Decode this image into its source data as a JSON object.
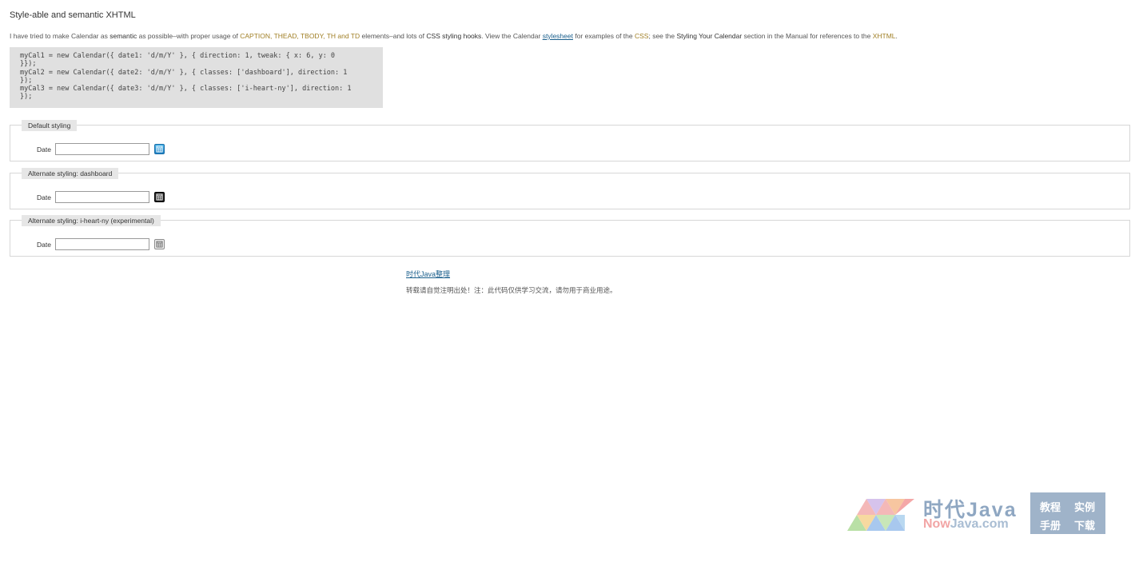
{
  "heading": "Style-able and semantic XHTML",
  "intro": {
    "t1": "I have tried to make Calendar as ",
    "semantic": "semantic",
    "t2": " as possible–with proper usage of ",
    "tags": "CAPTION, THEAD, TBODY, TH and TD",
    "t3": " elements–and lots of ",
    "css_hooks": "CSS styling hooks",
    "t4": ". View the Calendar ",
    "stylesheet_link": "stylesheet",
    "t5": " for examples of the ",
    "css": "CSS",
    "t6": "; see the ",
    "styling_section": "Styling Your Calendar",
    "t7": " section in the Manual for references to the ",
    "xhtml": "XHTML",
    "t8": "."
  },
  "code": "myCal1 = new Calendar({ date1: 'd/m/Y' }, { direction: 1, tweak: { x: 6, y: 0\n}});\nmyCal2 = new Calendar({ date2: 'd/m/Y' }, { classes: ['dashboard'], direction: 1\n});\nmyCal3 = new Calendar({ date3: 'd/m/Y' }, { classes: ['i-heart-ny'], direction: 1\n});",
  "demos": [
    {
      "legend": "Default styling",
      "label": "Date",
      "value": "",
      "icon": "calendar-icon",
      "color": "#2a93d5"
    },
    {
      "legend": "Alternate styling: dashboard",
      "label": "Date",
      "value": "",
      "icon": "calendar-icon",
      "color": "#222222"
    },
    {
      "legend": "Alternate styling: i-heart-ny (experimental)",
      "label": "Date",
      "value": "",
      "icon": "calendar-icon",
      "color": "#f1f1f1"
    }
  ],
  "credit_link": "时代Java整理",
  "notice": "转载请自觉注明出处！注：此代码仅供学习交流，请勿用于商业用途。",
  "watermark": {
    "cn": "时代Java",
    "url_now": "Now",
    "url_rest": "Java.com",
    "box": [
      "教程",
      "实例",
      "手册",
      "下载"
    ]
  }
}
